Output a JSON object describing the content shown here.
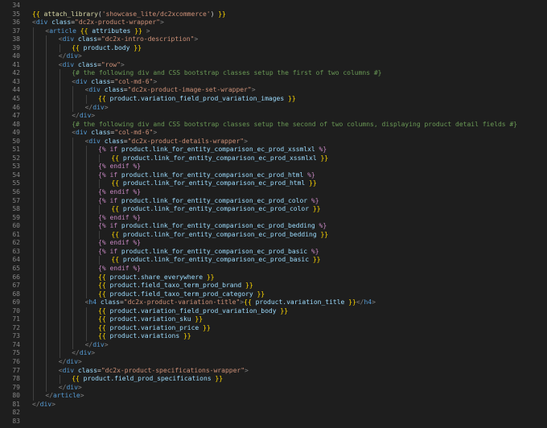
{
  "editor": {
    "language": "twig",
    "theme": "dark"
  },
  "lines": [
    {
      "n": "34",
      "indent": 0,
      "tokens": []
    },
    {
      "n": "35",
      "indent": 0,
      "tokens": [
        [
          "brace",
          "{{ "
        ],
        [
          "fn",
          "attach_library"
        ],
        [
          "txt",
          "("
        ],
        [
          "str",
          "'showcase_lite/dc2xcommerce'"
        ],
        [
          "txt",
          ")"
        ],
        [
          "brace",
          " }}"
        ]
      ]
    },
    {
      "n": "36",
      "indent": 0,
      "tokens": [
        [
          "ang",
          "<"
        ],
        [
          "tag",
          "div"
        ],
        [
          "attr",
          " class"
        ],
        [
          "txt",
          "="
        ],
        [
          "str",
          "\"dc2x-product-wrapper\""
        ],
        [
          "ang",
          ">"
        ]
      ]
    },
    {
      "n": "37",
      "indent": 1,
      "tokens": [
        [
          "ang",
          "<"
        ],
        [
          "tag",
          "article"
        ],
        [
          "brace",
          " {{ "
        ],
        [
          "var",
          "attributes"
        ],
        [
          "brace",
          " }}"
        ],
        [
          "ang",
          " >"
        ]
      ]
    },
    {
      "n": "38",
      "indent": 2,
      "tokens": [
        [
          "ang",
          "<"
        ],
        [
          "tag",
          "div"
        ],
        [
          "attr",
          " class"
        ],
        [
          "txt",
          "="
        ],
        [
          "str",
          "\"dc2x-intro-description\""
        ],
        [
          "ang",
          ">"
        ]
      ]
    },
    {
      "n": "39",
      "indent": 3,
      "tokens": [
        [
          "brace",
          "{{ "
        ],
        [
          "var",
          "product.body"
        ],
        [
          "brace",
          " }}"
        ]
      ]
    },
    {
      "n": "40",
      "indent": 2,
      "tokens": [
        [
          "ang",
          "</"
        ],
        [
          "tag",
          "div"
        ],
        [
          "ang",
          ">"
        ]
      ]
    },
    {
      "n": "41",
      "indent": 2,
      "tokens": [
        [
          "ang",
          "<"
        ],
        [
          "tag",
          "div"
        ],
        [
          "attr",
          " class"
        ],
        [
          "txt",
          "="
        ],
        [
          "str",
          "\"row\""
        ],
        [
          "ang",
          ">"
        ]
      ]
    },
    {
      "n": "42",
      "indent": 3,
      "tokens": [
        [
          "cmt",
          "{# the following div and CSS bootstrap classes setup the first of two columns #}"
        ]
      ]
    },
    {
      "n": "43",
      "indent": 3,
      "tokens": [
        [
          "ang",
          "<"
        ],
        [
          "tag",
          "div"
        ],
        [
          "attr",
          " class"
        ],
        [
          "txt",
          "="
        ],
        [
          "str",
          "\"col-md-6\""
        ],
        [
          "ang",
          ">"
        ]
      ]
    },
    {
      "n": "44",
      "indent": 4,
      "tokens": [
        [
          "ang",
          "<"
        ],
        [
          "tag",
          "div"
        ],
        [
          "attr",
          " class"
        ],
        [
          "txt",
          "="
        ],
        [
          "str",
          "\"dc2x-product-image-set-wrapper\""
        ],
        [
          "ang",
          ">"
        ]
      ]
    },
    {
      "n": "45",
      "indent": 5,
      "tokens": [
        [
          "brace",
          "{{ "
        ],
        [
          "var",
          "product.variation_field_prod_variation_images"
        ],
        [
          "brace",
          " }}"
        ]
      ]
    },
    {
      "n": "46",
      "indent": 4,
      "tokens": [
        [
          "ang",
          "</"
        ],
        [
          "tag",
          "div"
        ],
        [
          "ang",
          ">"
        ]
      ]
    },
    {
      "n": "47",
      "indent": 3,
      "tokens": [
        [
          "ang",
          "</"
        ],
        [
          "tag",
          "div"
        ],
        [
          "ang",
          ">"
        ]
      ]
    },
    {
      "n": "48",
      "indent": 3,
      "tokens": [
        [
          "cmt",
          "{# the following div and CSS bootstrap classes setup the second of two columns, displaying product detail fields #}"
        ]
      ]
    },
    {
      "n": "49",
      "indent": 3,
      "tokens": [
        [
          "ang",
          "<"
        ],
        [
          "tag",
          "div"
        ],
        [
          "attr",
          " class"
        ],
        [
          "txt",
          "="
        ],
        [
          "str",
          "\"col-md-6\""
        ],
        [
          "ang",
          ">"
        ]
      ]
    },
    {
      "n": "50",
      "indent": 4,
      "tokens": [
        [
          "ang",
          "<"
        ],
        [
          "tag",
          "div"
        ],
        [
          "attr",
          " class"
        ],
        [
          "txt",
          "="
        ],
        [
          "str",
          "\"dc2x-product-details-wrapper\""
        ],
        [
          "ang",
          ">"
        ]
      ]
    },
    {
      "n": "51",
      "indent": 5,
      "tokens": [
        [
          "kw",
          "{% "
        ],
        [
          "kw",
          "if "
        ],
        [
          "var",
          "product.link_for_entity_comparison_ec_prod_xssmlxl"
        ],
        [
          "kw",
          " %}"
        ]
      ]
    },
    {
      "n": "52",
      "indent": 6,
      "tokens": [
        [
          "brace",
          "{{ "
        ],
        [
          "var",
          "product.link_for_entity_comparison_ec_prod_xssmlxl"
        ],
        [
          "brace",
          " }}"
        ]
      ]
    },
    {
      "n": "53",
      "indent": 5,
      "tokens": [
        [
          "kw",
          "{% endif %}"
        ]
      ]
    },
    {
      "n": "54",
      "indent": 5,
      "tokens": [
        [
          "kw",
          "{% "
        ],
        [
          "kw",
          "if "
        ],
        [
          "var",
          "product.link_for_entity_comparison_ec_prod_html"
        ],
        [
          "kw",
          " %}"
        ]
      ]
    },
    {
      "n": "55",
      "indent": 6,
      "tokens": [
        [
          "brace",
          "{{ "
        ],
        [
          "var",
          "product.link_for_entity_comparison_ec_prod_html"
        ],
        [
          "brace",
          " }}"
        ]
      ]
    },
    {
      "n": "56",
      "indent": 5,
      "tokens": [
        [
          "kw",
          "{% endif %}"
        ]
      ]
    },
    {
      "n": "57",
      "indent": 5,
      "tokens": [
        [
          "kw",
          "{% "
        ],
        [
          "kw",
          "if "
        ],
        [
          "var",
          "product.link_for_entity_comparison_ec_prod_color"
        ],
        [
          "kw",
          " %}"
        ]
      ]
    },
    {
      "n": "58",
      "indent": 6,
      "tokens": [
        [
          "brace",
          "{{ "
        ],
        [
          "var",
          "product.link_for_entity_comparison_ec_prod_color"
        ],
        [
          "brace",
          " }}"
        ]
      ]
    },
    {
      "n": "59",
      "indent": 5,
      "tokens": [
        [
          "kw",
          "{% endif %}"
        ]
      ]
    },
    {
      "n": "60",
      "indent": 5,
      "tokens": [
        [
          "kw",
          "{% "
        ],
        [
          "kw",
          "if "
        ],
        [
          "var",
          "product.link_for_entity_comparison_ec_prod_bedding"
        ],
        [
          "kw",
          " %}"
        ]
      ]
    },
    {
      "n": "61",
      "indent": 6,
      "tokens": [
        [
          "brace",
          "{{ "
        ],
        [
          "var",
          "product.link_for_entity_comparison_ec_prod_bedding"
        ],
        [
          "brace",
          " }}"
        ]
      ]
    },
    {
      "n": "62",
      "indent": 5,
      "tokens": [
        [
          "kw",
          "{% endif %}"
        ]
      ]
    },
    {
      "n": "63",
      "indent": 5,
      "tokens": [
        [
          "kw",
          "{% "
        ],
        [
          "kw",
          "if "
        ],
        [
          "var",
          "product.link_for_entity_comparison_ec_prod_basic"
        ],
        [
          "kw",
          " %}"
        ]
      ]
    },
    {
      "n": "64",
      "indent": 6,
      "tokens": [
        [
          "brace",
          "{{ "
        ],
        [
          "var",
          "product.link_for_entity_comparison_ec_prod_basic"
        ],
        [
          "brace",
          " }}"
        ]
      ]
    },
    {
      "n": "65",
      "indent": 5,
      "tokens": [
        [
          "kw",
          "{% endif %}"
        ]
      ]
    },
    {
      "n": "66",
      "indent": 5,
      "tokens": [
        [
          "brace",
          "{{ "
        ],
        [
          "var",
          "product.share_everywhere"
        ],
        [
          "brace",
          " }}"
        ]
      ]
    },
    {
      "n": "67",
      "indent": 5,
      "tokens": [
        [
          "brace",
          "{{ "
        ],
        [
          "var",
          "product.field_taxo_term_prod_brand"
        ],
        [
          "brace",
          " }}"
        ]
      ]
    },
    {
      "n": "68",
      "indent": 5,
      "tokens": [
        [
          "brace",
          "{{ "
        ],
        [
          "var",
          "product.field_taxo_term_prod_category"
        ],
        [
          "brace",
          " }}"
        ]
      ]
    },
    {
      "n": "69",
      "indent": 4,
      "tokens": [
        [
          "ang",
          "<"
        ],
        [
          "tag",
          "h4"
        ],
        [
          "attr",
          " class"
        ],
        [
          "txt",
          "="
        ],
        [
          "str",
          "\"dc2x-product-variation-title\""
        ],
        [
          "ang",
          ">"
        ],
        [
          "brace",
          "{{ "
        ],
        [
          "var",
          "product.variation_title"
        ],
        [
          "brace",
          " }}"
        ],
        [
          "ang",
          "</"
        ],
        [
          "tag",
          "h4"
        ],
        [
          "ang",
          ">"
        ]
      ]
    },
    {
      "n": "70",
      "indent": 5,
      "tokens": [
        [
          "brace",
          "{{ "
        ],
        [
          "var",
          "product.variation_field_prod_variation_body"
        ],
        [
          "brace",
          " }}"
        ]
      ]
    },
    {
      "n": "71",
      "indent": 5,
      "tokens": [
        [
          "brace",
          "{{ "
        ],
        [
          "var",
          "product.variation_sku"
        ],
        [
          "brace",
          " }}"
        ]
      ]
    },
    {
      "n": "72",
      "indent": 5,
      "tokens": [
        [
          "brace",
          "{{ "
        ],
        [
          "var",
          "product.variation_price"
        ],
        [
          "brace",
          " }}"
        ]
      ]
    },
    {
      "n": "73",
      "indent": 5,
      "tokens": [
        [
          "brace",
          "{{ "
        ],
        [
          "var",
          "product.variations"
        ],
        [
          "brace",
          " }}"
        ]
      ]
    },
    {
      "n": "74",
      "indent": 4,
      "tokens": [
        [
          "ang",
          "</"
        ],
        [
          "tag",
          "div"
        ],
        [
          "ang",
          ">"
        ]
      ]
    },
    {
      "n": "75",
      "indent": 3,
      "tokens": [
        [
          "ang",
          "</"
        ],
        [
          "tag",
          "div"
        ],
        [
          "ang",
          ">"
        ]
      ]
    },
    {
      "n": "76",
      "indent": 2,
      "tokens": [
        [
          "ang",
          "</"
        ],
        [
          "tag",
          "div"
        ],
        [
          "ang",
          ">"
        ]
      ]
    },
    {
      "n": "77",
      "indent": 2,
      "tokens": [
        [
          "ang",
          "<"
        ],
        [
          "tag",
          "div"
        ],
        [
          "attr",
          " class"
        ],
        [
          "txt",
          "="
        ],
        [
          "str",
          "\"dc2x-product-specifications-wrapper\""
        ],
        [
          "ang",
          ">"
        ]
      ]
    },
    {
      "n": "78",
      "indent": 3,
      "tokens": [
        [
          "brace",
          "{{ "
        ],
        [
          "var",
          "product.field_prod_specifications"
        ],
        [
          "brace",
          " }}"
        ]
      ]
    },
    {
      "n": "79",
      "indent": 2,
      "tokens": [
        [
          "ang",
          "</"
        ],
        [
          "tag",
          "div"
        ],
        [
          "ang",
          ">"
        ]
      ]
    },
    {
      "n": "80",
      "indent": 1,
      "tokens": [
        [
          "ang",
          "</"
        ],
        [
          "tag",
          "article"
        ],
        [
          "ang",
          ">"
        ]
      ]
    },
    {
      "n": "81",
      "indent": 0,
      "tokens": [
        [
          "ang",
          "</"
        ],
        [
          "tag",
          "div"
        ],
        [
          "ang",
          ">"
        ]
      ]
    },
    {
      "n": "82",
      "indent": 0,
      "tokens": []
    },
    {
      "n": "83",
      "indent": 0,
      "tokens": []
    }
  ]
}
